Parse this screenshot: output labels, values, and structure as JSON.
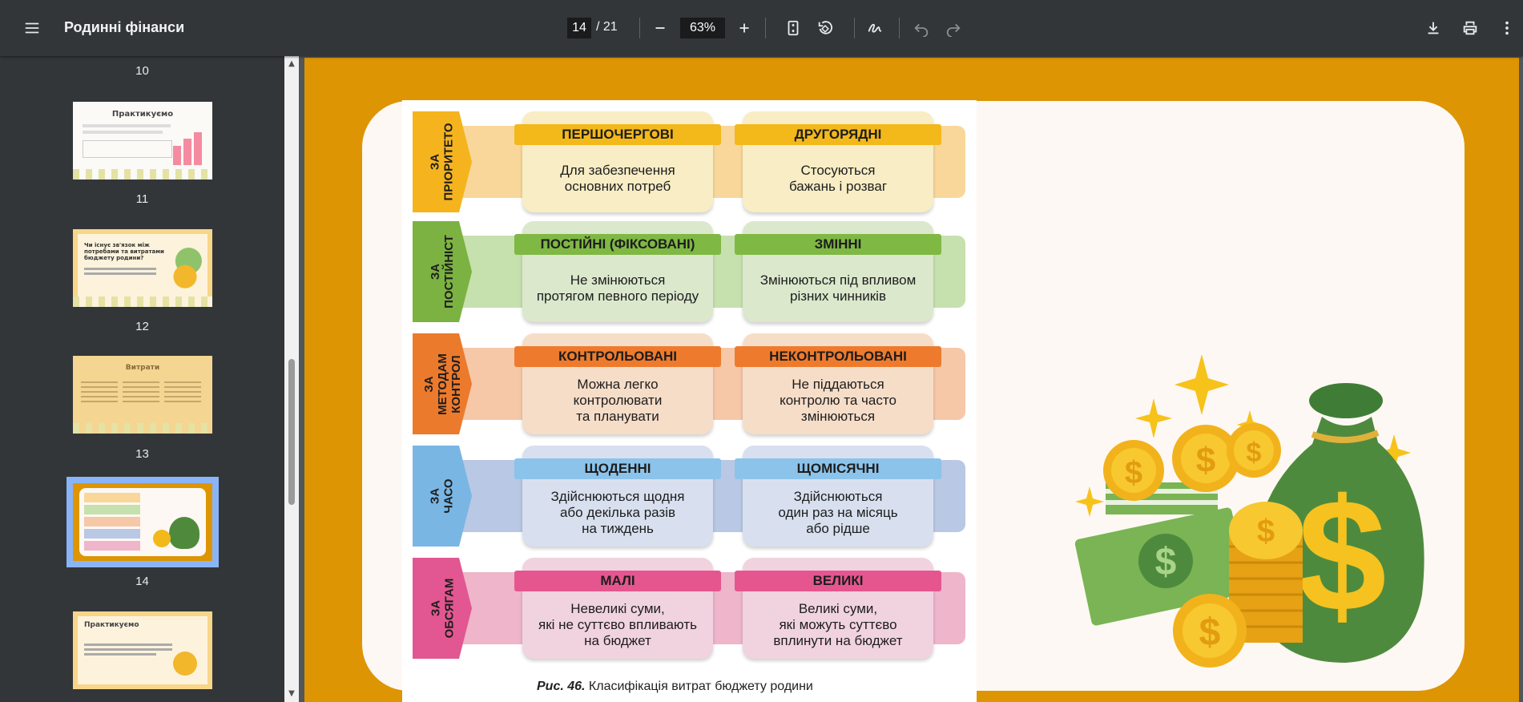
{
  "toolbar": {
    "title": "Родинні фінанси",
    "page_current": "14",
    "page_total": "/ 21",
    "zoom": "63%",
    "icons": [
      "menu-icon",
      "zoom-out-icon",
      "zoom-in-icon",
      "fit-page-icon",
      "rotate-icon",
      "draw-icon",
      "undo-icon",
      "redo-icon",
      "download-icon",
      "print-icon",
      "more-icon"
    ]
  },
  "sidebar": {
    "thumbnails": [
      {
        "number": "10"
      },
      {
        "number": "11",
        "title": "Практикуємо"
      },
      {
        "number": "12",
        "title": "Чи існує зв'язок між потребами та витратами бюджету родини?"
      },
      {
        "number": "13",
        "title": "Витрати"
      },
      {
        "number": "14",
        "selected": true
      },
      {
        "title": "Практикуємо"
      }
    ]
  },
  "slide": {
    "rows": [
      {
        "tag": "ЗА\nПРІОРИТЕТО",
        "color": "#f5b41d",
        "band": "#f9d79a",
        "cell_bg": "#f8edc4",
        "head": "#f3b81a",
        "left_head": "ПЕРШОЧЕРГОВІ",
        "left_body": "Для забезпечення\nосновних потреб",
        "right_head": "ДРУГОРЯДНІ",
        "right_body": "Стосуються\nбажань і розваг"
      },
      {
        "tag": "ЗА\nПОСТІЙНІСТ",
        "color": "#7bb241",
        "band": "#c6e0ae",
        "cell_bg": "#dbe8cc",
        "head": "#7fb843",
        "left_head": "ПОСТІЙНІ (ФІКСОВАНІ)",
        "left_body": "Не змінюються\nпротягом певного періоду",
        "right_head": "ЗМІННІ",
        "right_body": "Змінюються під впливом\nрізних чинників"
      },
      {
        "tag": "ЗА\nМЕТОДАМ\nКОНТРОЛ",
        "color": "#ec7a2c",
        "band": "#f6c8a8",
        "cell_bg": "#f6ddc8",
        "head": "#ee7b2d",
        "left_head": "КОНТРОЛЬОВАНІ",
        "left_body": "Можна легко\nконтролювати\nта планувати",
        "right_head": "НЕКОНТРОЛЬОВАНІ",
        "right_body": "Не піддаються\nконтролю та часто\nзмінюються"
      },
      {
        "tag": "ЗА\nЧАСО",
        "color": "#7ab6e4",
        "band": "#b9c8e4",
        "cell_bg": "#d8e0ef",
        "head": "#8cc3ea",
        "left_head": "ЩОДЕННІ",
        "left_body": "Здійснюються щодня\nабо декілька разів\nна тиждень",
        "right_head": "ЩОМІСЯЧНІ",
        "right_body": "Здійснюються\nодин раз на місяць\nабо рідше"
      },
      {
        "tag": "ЗА\nОБСЯГАМ",
        "color": "#e25791",
        "band": "#eeb5cb",
        "cell_bg": "#f1d3df",
        "head": "#e5568f",
        "left_head": "МАЛІ",
        "left_body": "Невеликі суми,\nякі не суттєво впливають\nна бюджет",
        "right_head": "ВЕЛИКІ",
        "right_body": "Великі суми,\nякі можуть суттєво\nвплинути на бюджет"
      }
    ],
    "caption_bold": "Рис. 46.",
    "caption_text": " Класифікація витрат бюджету родини"
  },
  "colors": {
    "page_bg": "#dd9504",
    "toolbar_bg": "#323639",
    "selected_thumb": "#8ab4f8"
  }
}
